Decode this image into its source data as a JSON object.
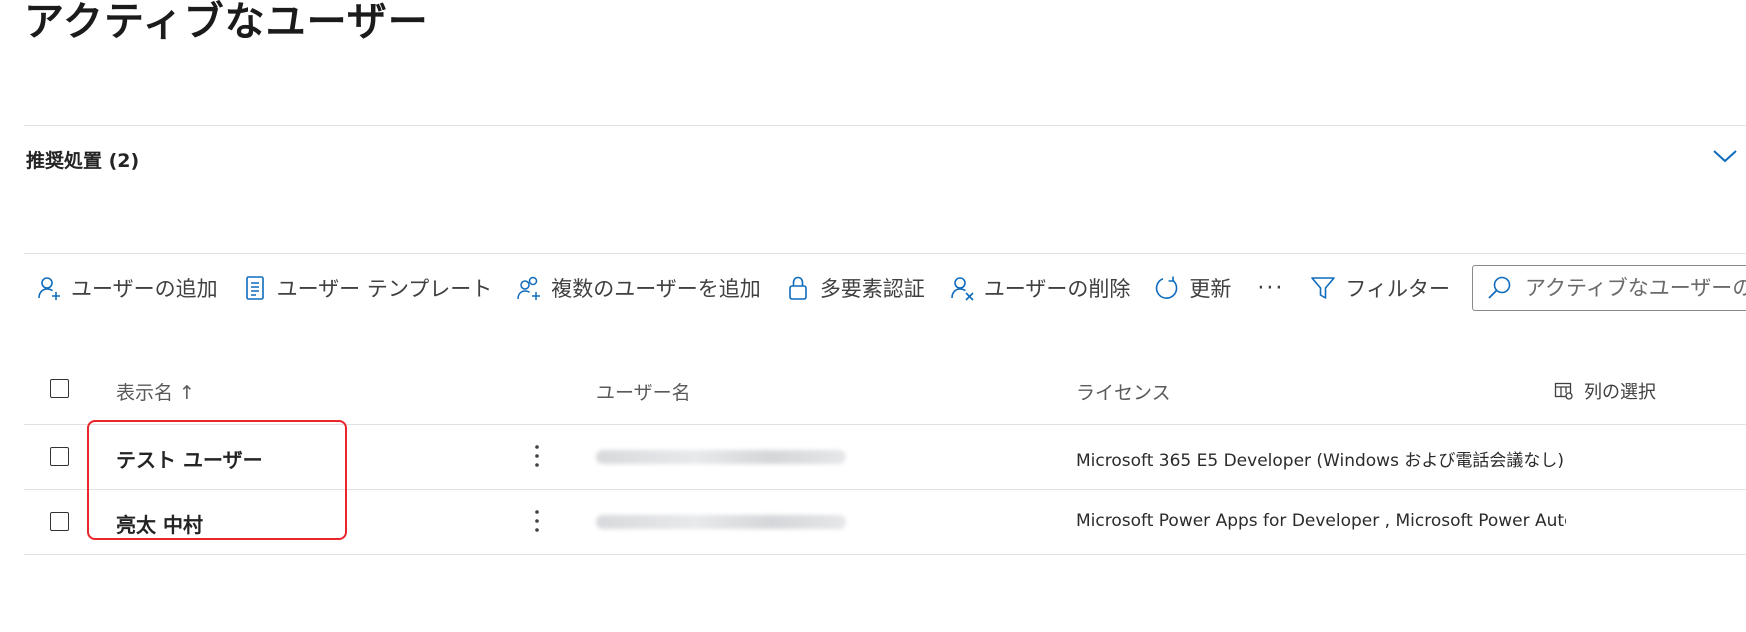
{
  "page": {
    "title": "アクティブなユーザー"
  },
  "recommendations": {
    "label": "推奨処置 (2)"
  },
  "toolbar": {
    "add_user": "ユーザーの追加",
    "user_templates": "ユーザー テンプレート",
    "add_multiple": "複数のユーザーを追加",
    "mfa": "多要素認証",
    "delete_user": "ユーザーの削除",
    "refresh": "更新",
    "more": "···",
    "filter": "フィルター",
    "search_placeholder": "アクティブなユーザーの検索"
  },
  "table": {
    "headers": {
      "display_name": "表示名 ↑",
      "username": "ユーザー名",
      "license": "ライセンス",
      "choose_columns": "列の選択"
    },
    "rows": [
      {
        "display_name": "テスト ユーザー",
        "license": "Microsoft 365 E5 Developer (Windows および電話会議なし)"
      },
      {
        "display_name": "亮太 中村",
        "license": "Microsoft Power Apps for Developer , Microsoft Power Automate Free"
      }
    ]
  },
  "colors": {
    "accent": "#0f6cbd",
    "highlight": "#e8262b"
  },
  "icons": {
    "add_user": "person-add-icon",
    "user_templates": "document-list-icon",
    "add_multiple": "people-add-icon",
    "mfa": "lock-icon",
    "delete_user": "person-delete-icon",
    "refresh": "refresh-icon",
    "filter": "filter-icon",
    "search": "search-icon",
    "choose_columns": "column-picker-icon",
    "expand": "chevron-down-icon"
  }
}
